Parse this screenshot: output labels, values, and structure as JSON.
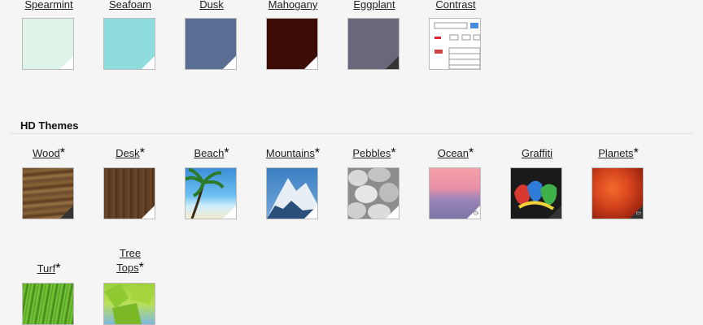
{
  "basic_themes": [
    {
      "name": "Spearmint",
      "color": "#dff4e8"
    },
    {
      "name": "Seafoam",
      "color": "#8fdcdc"
    },
    {
      "name": "Dusk",
      "color": "#5a6e94"
    },
    {
      "name": "Mahogany",
      "color": "#3b0d06"
    },
    {
      "name": "Eggplant",
      "color": "#6b6679"
    },
    {
      "name": "Contrast",
      "color": "#ffffff"
    }
  ],
  "hd_section_title": "HD Themes",
  "hd_themes": [
    {
      "name": "Wood",
      "star": "*"
    },
    {
      "name": "Desk",
      "star": "*"
    },
    {
      "name": "Beach",
      "star": "*"
    },
    {
      "name": "Mountains",
      "star": "*"
    },
    {
      "name": "Pebbles",
      "star": "*"
    },
    {
      "name": "Ocean",
      "star": "*"
    },
    {
      "name": "Graffiti",
      "star": ""
    },
    {
      "name": "Planets",
      "star": "*"
    }
  ],
  "hd_themes_row2": [
    {
      "name": "Turf",
      "star": "*"
    },
    {
      "name_line1": "Tree",
      "name_line2": "Tops",
      "star": "*"
    }
  ],
  "icons": {
    "hd_badge": "hd-badge-icon",
    "clock": "clock-icon"
  }
}
